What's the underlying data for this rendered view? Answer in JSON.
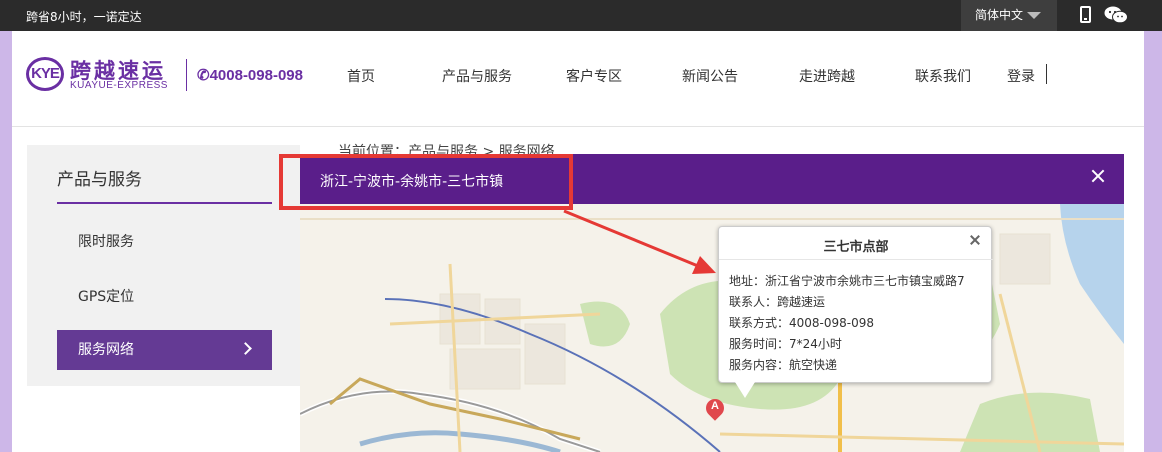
{
  "topbar": {
    "slogan": "跨省8小时，一诺定达",
    "language": "简体中文",
    "icons": [
      "mobile-phone-icon",
      "wechat-icon"
    ]
  },
  "header": {
    "logo": {
      "abbr": "KYE",
      "cn": "跨越速运",
      "en": "KUAYUE-EXPRESS"
    },
    "hotline": "✆4008-098-098",
    "nav": [
      "首页",
      "产品与服务",
      "客户专区",
      "新闻公告",
      "走进跨越",
      "联系我们"
    ],
    "login": "登录"
  },
  "sidebar": {
    "title": "产品与服务",
    "items": [
      "限时服务",
      "GPS定位",
      "服务网络"
    ],
    "active_index": 2
  },
  "breadcrumb": "当前位置：产品与服务 > 服务网络",
  "modal": {
    "title": "浙江-宁波市-余姚市-三七市镇",
    "close_icon": "close-icon"
  },
  "infowindow": {
    "title": "三七市点部",
    "lines": [
      "地址：浙江省宁波市余姚市三七市镇宝威路7",
      "联系人：跨越速运",
      "联系方式：4008-098-098",
      "服务时间：7*24小时",
      "服务内容：航空快递"
    ]
  },
  "map_marker": {
    "label": "A"
  },
  "colors": {
    "brand_purple": "#6a2fa3",
    "modal_header": "#5a1e8a",
    "highlight_red": "#e53935",
    "topbar": "#2b2b2b"
  }
}
